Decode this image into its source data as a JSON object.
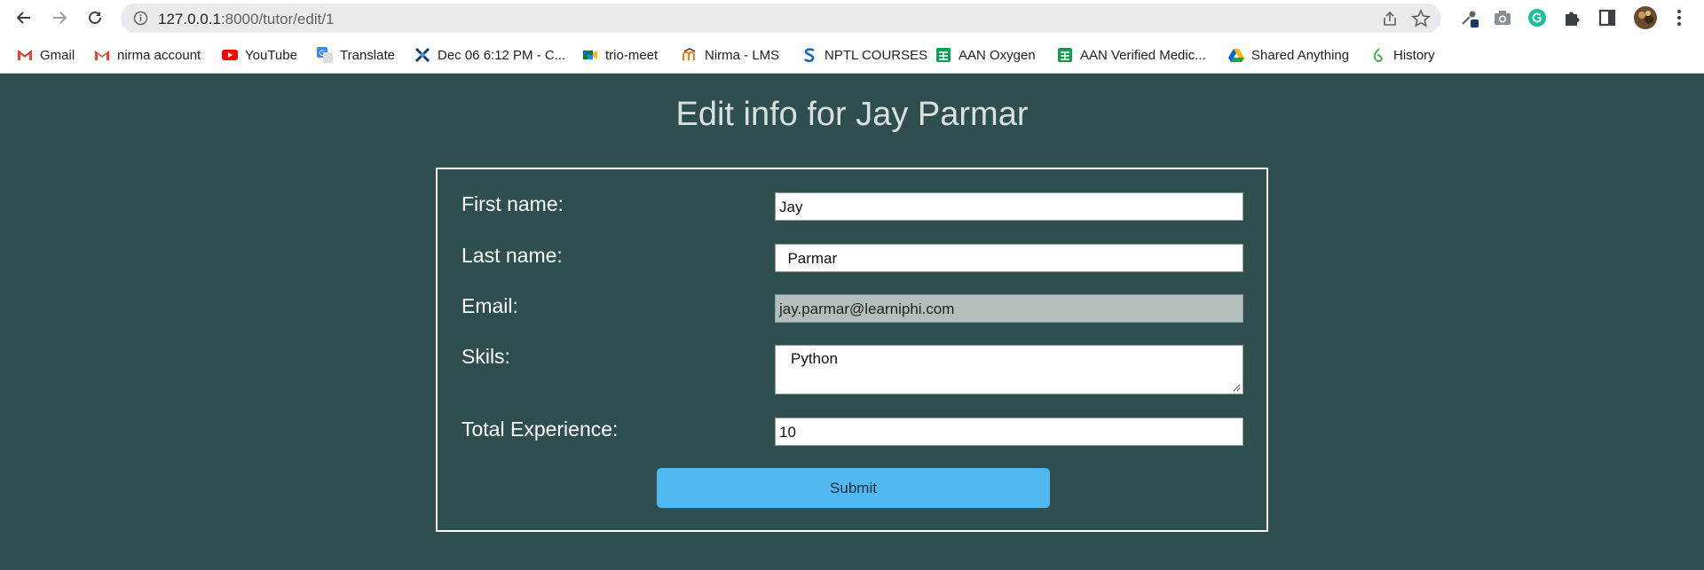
{
  "browser": {
    "url_host": "127.0.0.1",
    "url_path": ":8000/tutor/edit/1"
  },
  "bookmarks": [
    {
      "label": "Gmail",
      "icon": "gmail-icon"
    },
    {
      "label": "nirma account",
      "icon": "gmail-icon"
    },
    {
      "label": "YouTube",
      "icon": "youtube-icon"
    },
    {
      "label": "Translate",
      "icon": "translate-icon"
    },
    {
      "label": "Dec 06 6:12 PM - C...",
      "icon": "cross-icon"
    },
    {
      "label": "trio-meet",
      "icon": "meet-icon"
    },
    {
      "label": "Nirma - LMS",
      "icon": "moodle-icon"
    },
    {
      "label": "NPTL COURSES",
      "icon": "s-icon"
    },
    {
      "label": "AAN Oxygen",
      "icon": "sheets-icon"
    },
    {
      "label": "AAN Verified Medic...",
      "icon": "sheets-icon"
    },
    {
      "label": "Shared Anything",
      "icon": "drive-icon"
    },
    {
      "label": "History",
      "icon": "history-icon"
    }
  ],
  "page": {
    "title": "Edit info for Jay Parmar",
    "form": {
      "first_name_label": "First name:",
      "first_name_value": "Jay",
      "last_name_label": "Last name:",
      "last_name_value": "  Parmar",
      "email_label": "Email:",
      "email_value": "jay.parmar@learniphi.com",
      "skills_label": "Skils:",
      "skills_value": "Python",
      "experience_label": "Total Experience:",
      "experience_value": "10",
      "submit_label": "Submit"
    }
  },
  "colors": {
    "background": "#2f4f4f",
    "submit": "#4fb8ee"
  }
}
